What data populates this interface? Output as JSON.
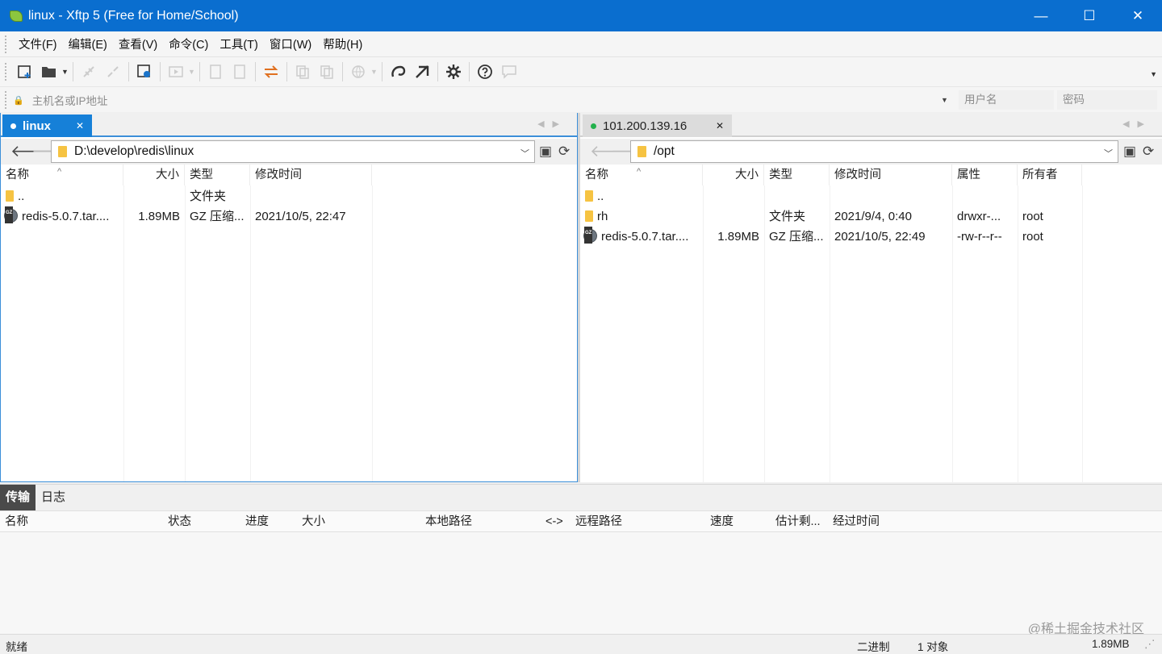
{
  "window": {
    "title": "linux - Xftp 5 (Free for Home/School)",
    "minimize_glyph": "—",
    "maximize_glyph": "☐",
    "close_glyph": "✕"
  },
  "menu": [
    "文件(F)",
    "编辑(E)",
    "查看(V)",
    "命令(C)",
    "工具(T)",
    "窗口(W)",
    "帮助(H)"
  ],
  "toolbar": {
    "icons": [
      "new-session-icon",
      "open-folder-icon",
      "connect-icon",
      "disconnect-icon",
      "session-properties-icon",
      "transfer-icon",
      "local-file-icon",
      "remote-file-icon",
      "sync-icon",
      "copy-icon",
      "paste-icon",
      "globe-icon",
      "xshell-icon",
      "xftp-icon",
      "options-icon",
      "help-icon",
      "chat-icon"
    ]
  },
  "address": {
    "host_placeholder": "主机名或IP地址",
    "user_placeholder": "用户名",
    "password_placeholder": "密码"
  },
  "left_pane": {
    "tab_label": "linux",
    "tab_dot_color": "#ffffff",
    "path": "D:\\develop\\redis\\linux",
    "columns": [
      "名称",
      "大小",
      "类型",
      "修改时间"
    ],
    "rows": [
      {
        "icon": "folder-icon",
        "name": "..",
        "size": "",
        "type": "文件夹",
        "modified": ""
      },
      {
        "icon": "gz-archive-icon",
        "name": "redis-5.0.7.tar....",
        "size": "1.89MB",
        "type": "GZ 压缩...",
        "modified": "2021/10/5, 22:47"
      }
    ]
  },
  "right_pane": {
    "tab_label": "101.200.139.16",
    "tab_dot_color": "#22b14c",
    "path": "/opt",
    "columns": [
      "名称",
      "大小",
      "类型",
      "修改时间",
      "属性",
      "所有者"
    ],
    "rows": [
      {
        "icon": "folder-icon",
        "name": "..",
        "size": "",
        "type": "",
        "modified": "",
        "attrs": "",
        "owner": ""
      },
      {
        "icon": "folder-icon",
        "name": "rh",
        "size": "",
        "type": "文件夹",
        "modified": "2021/9/4, 0:40",
        "attrs": "drwxr-...",
        "owner": "root"
      },
      {
        "icon": "gz-archive-icon",
        "name": "redis-5.0.7.tar....",
        "size": "1.89MB",
        "type": "GZ 压缩...",
        "modified": "2021/10/5, 22:49",
        "attrs": "-rw-r--r--",
        "owner": "root"
      }
    ]
  },
  "transfer": {
    "tabs": [
      "传输",
      "日志"
    ],
    "columns": [
      "名称",
      "状态",
      "进度",
      "大小",
      "本地路径",
      "<->",
      "远程路径",
      "速度",
      "估计剩...",
      "经过时间"
    ]
  },
  "status": {
    "left": "就绪",
    "mode": "二进制",
    "objects": "1 对象",
    "size": "1.89MB"
  },
  "watermark": "@稀土掘金技术社区"
}
